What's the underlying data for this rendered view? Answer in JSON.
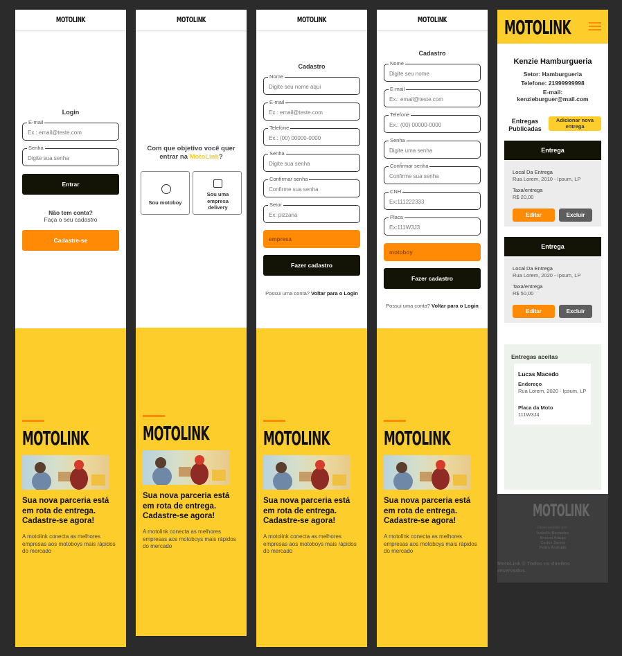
{
  "brand": {
    "logo": "MOTOLINK",
    "accent": "#fdcd2b",
    "orange": "#fe8a06",
    "dark": "#131306"
  },
  "hero": {
    "headline": "Sua nova parceria está em rota de entrega. Cadastre-se agora!",
    "description": "A motolink conecta as melhores empresas aos motoboys mais rápidos do mercado"
  },
  "login": {
    "title": "Login",
    "email_label": "E-mail",
    "email_placeholder": "Ex.: email@teste.com",
    "password_label": "Senha",
    "password_placeholder": "Digite sua senha",
    "submit": "Entrar",
    "no_account": "Não tem conta?",
    "signup_hint": "Faça o seu cadastro",
    "signup_button": "Cadastre-se"
  },
  "objective": {
    "question_prefix": "Com que objetivo você quer entrar na",
    "brand_word": "MotoLink",
    "question_suffix": "?",
    "option_motoboy": "Sou motoboy",
    "option_company": "Sou uma empresa delivery"
  },
  "company_signup": {
    "title": "Cadastro",
    "fields": [
      {
        "label": "Nome",
        "placeholder": "Digite seu nome aqui"
      },
      {
        "label": "E-mail",
        "placeholder": "Ex.: email@teste.com"
      },
      {
        "label": "Telefone",
        "placeholder": "Ex.: (00) 00000-0000"
      },
      {
        "label": "Senha",
        "placeholder": "Digite sua senha"
      },
      {
        "label": "Confirmar senha",
        "placeholder": "Confirme sua senha"
      },
      {
        "label": "Setor",
        "placeholder": "Ex: pizzaria"
      }
    ],
    "type_value": "empresa",
    "submit": "Fazer cadastro",
    "has_account": "Possui uma conta?",
    "back_login": "Voltar para o Login"
  },
  "motoboy_signup": {
    "title": "Cadastro",
    "fields": [
      {
        "label": "Nome",
        "placeholder": "Digite seu nome"
      },
      {
        "label": "E-mail",
        "placeholder": "Ex.: email@teste.com"
      },
      {
        "label": "Telefone",
        "placeholder": "Ex.: (00) 00000-0000"
      },
      {
        "label": "Senha",
        "placeholder": "Digite uma senha"
      },
      {
        "label": "Confirmar senha",
        "placeholder": "Confirme sua senha"
      },
      {
        "label": "CNH",
        "placeholder": "Ex:111222333"
      },
      {
        "label": "Placa",
        "placeholder": "Ex:111W3J3"
      }
    ],
    "type_value": "motoboy",
    "submit": "Fazer cadastro",
    "has_account": "Possui uma conta?",
    "back_login": "Voltar para o Login"
  },
  "dashboard": {
    "company_name": "Kenzie Hamburgueria",
    "sector": "Setor: Hamburgueria",
    "phone": "Telefone: 21999999998",
    "email_label": "E-mail:",
    "email_value": "kenzieburguer@mail.com",
    "posted_title": "Entregas Publicadas",
    "add_button": "Adicionar nova entrega",
    "deliveries": [
      {
        "header": "Entrega",
        "place_label": "Local Da Entrega",
        "place": "Rua Lorem, 2010 - Ipsum, LP",
        "fee_label": "Taxa/entrega",
        "fee": "R$ 20,00",
        "edit": "Editar",
        "delete": "Excluir"
      },
      {
        "header": "Entrega",
        "place_label": "Local Da Entrega",
        "place": "Rua Lorem, 2020 - Ipsum, LP",
        "fee_label": "Taxa/entrega",
        "fee": "R$ 50,00",
        "edit": "Editar",
        "delete": "Excluir"
      }
    ],
    "accepted_title": "Entregas aceitas",
    "accepted": {
      "name": "Lucas Macedo",
      "address_label": "Endereço",
      "address": "Rua Lorem, 2020 - Ipsum, LP",
      "plate_label": "Placa da Moto",
      "plate": "111W3J4"
    },
    "footer_logo": "MOTOLINK",
    "footer_dev": "Desenvolvido por:",
    "footer_names": [
      "Isabelle Bernades",
      "Anouni Araujo",
      "Carlos Sanna",
      "Pedro Andrade"
    ],
    "footer_rights": "MotoLink © Todos os direitos reservados.",
    "menu_icon": "hamburger-menu-icon"
  }
}
